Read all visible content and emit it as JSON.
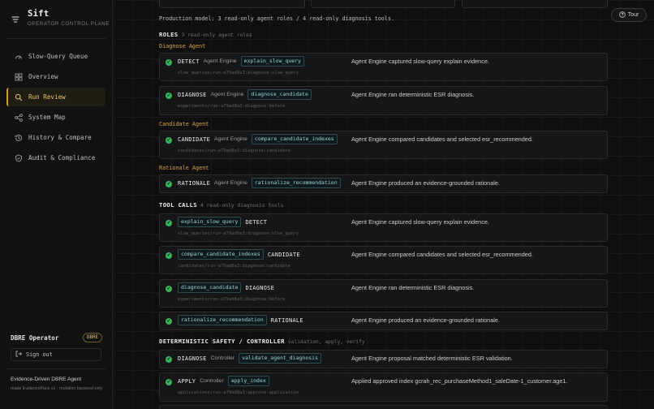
{
  "brand": {
    "name": "Sift",
    "subtitle": "OPERATOR CONTROL PLANE"
  },
  "nav": [
    {
      "label": "Slow-Query Queue",
      "icon": "gauge-icon",
      "active": false
    },
    {
      "label": "Overview",
      "icon": "grid-icon",
      "active": false
    },
    {
      "label": "Run Review",
      "icon": "magnifier-icon",
      "active": true
    },
    {
      "label": "System Map",
      "icon": "nodes-icon",
      "active": false
    },
    {
      "label": "History & Compare",
      "icon": "history-icon",
      "active": false
    },
    {
      "label": "Audit & Compliance",
      "icon": "shield-icon",
      "active": false
    }
  ],
  "operator": {
    "name": "DBRE Operator",
    "badge": "DBRE",
    "signout": "Sign out"
  },
  "footer": {
    "title": "Evidence-Driven DBRE Agent",
    "note": "reads EvidencePack v1 · mutation backend-only"
  },
  "tour_label": "Tour",
  "production_note": "Production model: 3 read-only agent roles / 4 read-only diagnosis tools.",
  "roles": {
    "title": "ROLES",
    "subtitle": "3 read-only agent roles",
    "groups": [
      {
        "name": "Diagnose Agent",
        "rows": [
          {
            "kw": "DETECT",
            "actor": "Agent Engine",
            "chip": "explain_slow_query",
            "path": "slow_queries/run-a79ad8a3:diagnose:slow_query",
            "desc": "Agent Engine captured slow-query explain evidence."
          },
          {
            "kw": "DIAGNOSE",
            "actor": "Agent Engine",
            "chip": "diagnose_candidate",
            "path": "experiments/run-a79ad8a3:diagnose:before",
            "desc": "Agent Engine ran deterministic ESR diagnosis."
          }
        ]
      },
      {
        "name": "Candidate Agent",
        "rows": [
          {
            "kw": "CANDIDATE",
            "actor": "Agent Engine",
            "chip": "compare_candidate_indexes",
            "path": "candidates/run-a79ad8a3:diagnose:candidate",
            "desc": "Agent Engine compared candidates and selected esr_recommended."
          }
        ]
      },
      {
        "name": "Rationale Agent",
        "rows": [
          {
            "kw": "RATIONALE",
            "actor": "Agent Engine",
            "chip": "rationalize_recommendation",
            "path": "",
            "desc": "Agent Engine produced an evidence-grounded rationale."
          }
        ]
      }
    ]
  },
  "tool_calls": {
    "title": "TOOL CALLS",
    "subtitle": "4 read-only diagnosis tools",
    "rows": [
      {
        "chip": "explain_slow_query",
        "kw": "DETECT",
        "path": "slow_queries/run-a79ad8a3:diagnose:slow_query",
        "desc": "Agent Engine captured slow-query explain evidence."
      },
      {
        "chip": "compare_candidate_indexes",
        "kw": "CANDIDATE",
        "path": "candidates/run-a79ad8a3:diagnose:candidate",
        "desc": "Agent Engine compared candidates and selected esr_recommended."
      },
      {
        "chip": "diagnose_candidate",
        "kw": "DIAGNOSE",
        "path": "experiments/run-a79ad8a3:diagnose:before",
        "desc": "Agent Engine ran deterministic ESR diagnosis."
      },
      {
        "chip": "rationalize_recommendation",
        "kw": "RATIONALE",
        "path": "",
        "desc": "Agent Engine produced an evidence-grounded rationale."
      }
    ]
  },
  "safety": {
    "title": "DETERMINISTIC SAFETY / CONTROLLER",
    "subtitle": "validation, apply, verify",
    "rows": [
      {
        "kw": "DIAGNOSE",
        "actor": "Controller",
        "chip": "validate_agent_diagnosis",
        "path": "",
        "desc": "Agent Engine proposal matched deterministic ESR validation."
      },
      {
        "kw": "APPLY",
        "actor": "Controller",
        "chip": "apply_index",
        "path": "applications/run-a79ad8a3:approve:application",
        "desc": "Applied approved index gcrah_rec_purchaseMethod1_saleDate-1_customer.age1."
      }
    ]
  }
}
